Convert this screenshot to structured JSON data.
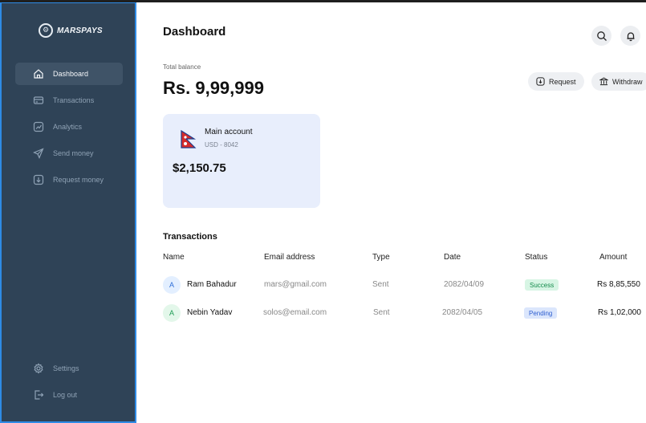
{
  "brand": {
    "logo_glyph": "⚙",
    "name": "MARSPAYS"
  },
  "sidebar": {
    "items": [
      {
        "label": "Dashboard",
        "icon": "home-icon",
        "active": true
      },
      {
        "label": "Transactions",
        "icon": "card-icon",
        "active": false
      },
      {
        "label": "Analytics",
        "icon": "chart-icon",
        "active": false
      },
      {
        "label": "Send money",
        "icon": "send-icon",
        "active": false
      },
      {
        "label": "Request money",
        "icon": "download-icon",
        "active": false
      }
    ],
    "bottom": [
      {
        "label": "Settings",
        "icon": "gear-icon"
      },
      {
        "label": "Log out",
        "icon": "logout-icon"
      }
    ]
  },
  "header": {
    "title": "Dashboard"
  },
  "balance": {
    "label": "Total balance",
    "value": "Rs. 9,99,999"
  },
  "actions": {
    "request_label": "Request",
    "withdraw_label": "Withdraw"
  },
  "account": {
    "name": "Main account",
    "sub": "USD - 8042",
    "amount": "$2,150.75",
    "flag": "nepal-flag"
  },
  "transactions": {
    "title": "Transactions",
    "columns": [
      "Name",
      "Email address",
      "Type",
      "Date",
      "Status",
      "Amount"
    ],
    "rows": [
      {
        "initial": "A",
        "name": "Ram Bahadur",
        "email": "mars@gmail.com",
        "type": "Sent",
        "date": "2082/04/09",
        "status": "Success",
        "amount": "Rs 8,85,550"
      },
      {
        "initial": "A",
        "name": "Nebin Yadav",
        "email": "solos@email.com",
        "type": "Sent",
        "date": "2082/04/05",
        "status": "Pending",
        "amount": "Rs 1,02,000"
      }
    ]
  },
  "colors": {
    "sidebar_bg": "#2f4357",
    "sidebar_active": "#3f5367",
    "card_bg": "#e8eefc",
    "success_bg": "#d7f5e4",
    "success_text": "#138a4b",
    "pending_bg": "#dbe6fc",
    "pending_text": "#2f5fd0"
  }
}
